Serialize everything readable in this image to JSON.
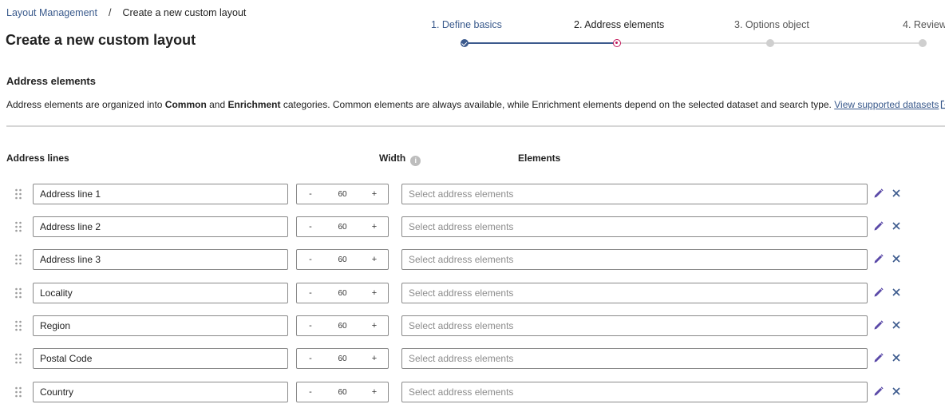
{
  "breadcrumb": {
    "parent": "Layout Management",
    "separator": "/",
    "current": "Create a new custom layout"
  },
  "page": {
    "title": "Create a new custom layout"
  },
  "steps": [
    {
      "label": "1. Define basics",
      "state": "done"
    },
    {
      "label": "2. Address elements",
      "state": "active"
    },
    {
      "label": "3. Options object",
      "state": "todo"
    },
    {
      "label": "4. Review",
      "state": "todo"
    }
  ],
  "section": {
    "title": "Address elements",
    "desc_1": "Address elements are organized into ",
    "bold_1": "Common",
    "desc_2": " and ",
    "bold_2": "Enrichment",
    "desc_3": " categories. Common elements are always available, while Enrichment elements depend on the selected dataset and search type. ",
    "link": "View supported datasets"
  },
  "columns": {
    "address_lines": "Address lines",
    "width": "Width",
    "elements": "Elements"
  },
  "rows": [
    {
      "name": "Address line 1",
      "minus": "-",
      "width": "60",
      "plus": "+",
      "placeholder": "Select address elements"
    },
    {
      "name": "Address line 2",
      "minus": "-",
      "width": "60",
      "plus": "+",
      "placeholder": "Select address elements"
    },
    {
      "name": "Address line 3",
      "minus": "-",
      "width": "60",
      "plus": "+",
      "placeholder": "Select address elements"
    },
    {
      "name": "Locality",
      "minus": "-",
      "width": "60",
      "plus": "+",
      "placeholder": "Select address elements"
    },
    {
      "name": "Region",
      "minus": "-",
      "width": "60",
      "plus": "+",
      "placeholder": "Select address elements"
    },
    {
      "name": "Postal Code",
      "minus": "-",
      "width": "60",
      "plus": "+",
      "placeholder": "Select address elements"
    },
    {
      "name": "Country",
      "minus": "-",
      "width": "60",
      "plus": "+",
      "placeholder": "Select address elements"
    }
  ],
  "colors": {
    "primary": "#3c5a8d",
    "active_step": "#c2185b",
    "icon_accent": "#5b4aa8",
    "border": "#8a8a8a"
  }
}
